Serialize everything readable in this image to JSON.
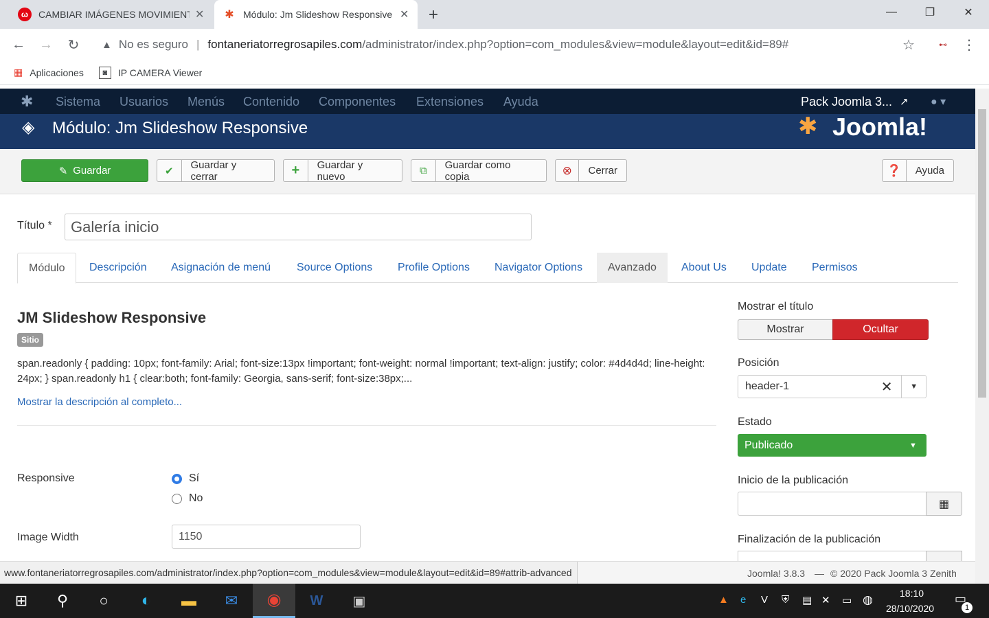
{
  "browser": {
    "tabs": [
      {
        "title": "CAMBIAR IMÁGENES MOVIMIENTO",
        "icon": "w-logo-icon"
      },
      {
        "title": "Módulo: Jm Slideshow Responsive",
        "icon": "joomla-favicon-icon"
      }
    ],
    "security_label": "No es seguro",
    "url_domain": "fontaneriatorregrosapiles.com",
    "url_path": "/administrator/index.php?option=com_modules&view=module&layout=edit&id=89#",
    "bookmarks": [
      "Aplicaciones",
      "IP CAMERA Viewer"
    ],
    "status_url": "www.fontaneriatorregrosapiles.com/administrator/index.php?option=com_modules&view=module&layout=edit&id=89#attrib-advanced"
  },
  "nav": {
    "items": [
      "Sistema",
      "Usuarios",
      "Menús",
      "Contenido",
      "Componentes",
      "Extensiones",
      "Ayuda"
    ],
    "site_name": "Pack Joomla 3..."
  },
  "header": {
    "title": "Módulo: Jm Slideshow Responsive",
    "logo_text": "Joomla!"
  },
  "toolbar": {
    "save": "Guardar",
    "save_close": "Guardar y cerrar",
    "save_new": "Guardar y nuevo",
    "save_copy": "Guardar como copia",
    "close": "Cerrar",
    "help": "Ayuda"
  },
  "form": {
    "title_label": "Título *",
    "title_value": "Galería inicio",
    "tabs": [
      "Módulo",
      "Descripción",
      "Asignación de menú",
      "Source Options",
      "Profile Options",
      "Navigator Options",
      "Avanzado",
      "About Us",
      "Update",
      "Permisos"
    ],
    "module_name": "JM Slideshow Responsive",
    "badge": "Sitio",
    "description": "span.readonly { padding: 10px; font-family: Arial; font-size:13px !important; font-weight: normal !important; text-align: justify; color: #4d4d4d; line-height: 24px; } span.readonly h1 { clear:both; font-family: Georgia, sans-serif; font-size:38px;...",
    "show_more": "Mostrar la descripción al completo...",
    "responsive_label": "Responsive",
    "opt_yes": "Sí",
    "opt_no": "No",
    "image_width_label": "Image Width",
    "image_width_value": "1150"
  },
  "sidebar": {
    "show_title_label": "Mostrar el título",
    "show": "Mostrar",
    "hide": "Ocultar",
    "position_label": "Posición",
    "position_value": "header-1",
    "state_label": "Estado",
    "state_value": "Publicado",
    "start_label": "Inicio de la publicación",
    "end_label": "Finalización de la publicación"
  },
  "footer": {
    "version": "Joomla! 3.8.3",
    "copyright": "© 2020 Pack Joomla 3 Zenith"
  },
  "taskbar": {
    "time": "18:10",
    "date": "28/10/2020",
    "notifications": "1"
  },
  "colors": {
    "nav_bg": "#0c1d34",
    "header_bg": "#1a3867",
    "save_green": "#3ca23c",
    "hide_red": "#d0262b"
  }
}
